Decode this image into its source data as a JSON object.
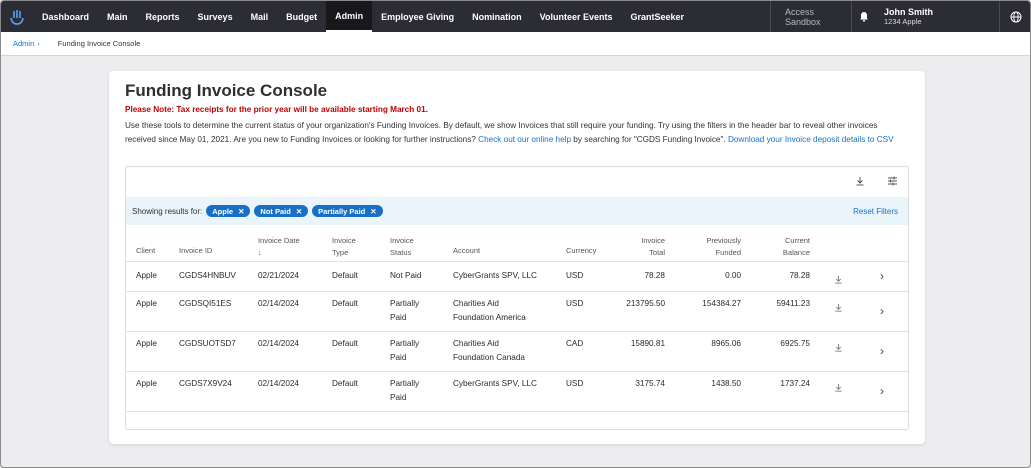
{
  "nav": {
    "items": [
      "Dashboard",
      "Main",
      "Reports",
      "Surveys",
      "Mail",
      "Budget",
      "Admin",
      "Employee Giving",
      "Nomination",
      "Volunteer Events",
      "GrantSeeker"
    ],
    "active": "Admin",
    "sandbox": "Access Sandbox",
    "user_name": "John Smith",
    "user_org": "1234 Apple"
  },
  "breadcrumb": {
    "parent": "Admin",
    "separator": "›",
    "current": "Funding Invoice Console"
  },
  "page": {
    "title": "Funding Invoice Console",
    "note": "Please Note: Tax receipts for the prior year will be available starting March 01.",
    "desc_1": "Use these tools to determine the current status of your organization's Funding Invoices. By default, we show Invoices that still require your funding. Try using the filters in the header bar to reveal other invoices received since May 01, 2021. Are you new to Funding Invoices or looking for further instructions? ",
    "help_link": "Check out our online help",
    "desc_2": " by searching for \"CGDS Funding Invoice\". ",
    "csv_link": "Download your Invoice deposit details to CSV"
  },
  "filters": {
    "label": "Showing results for:",
    "chips": [
      "Apple",
      "Not Paid",
      "Partially Paid"
    ],
    "reset": "Reset Filters"
  },
  "table": {
    "headers": {
      "client": "Client",
      "invoice_id": "Invoice ID",
      "invoice_date": "Invoice Date",
      "invoice_type_1": "Invoice",
      "invoice_type_2": "Type",
      "invoice_status_1": "Invoice",
      "invoice_status_2": "Status",
      "account": "Account",
      "currency": "Currency",
      "invoice_total_1": "Invoice",
      "invoice_total_2": "Total",
      "prev_funded_1": "Previously",
      "prev_funded_2": "Funded",
      "cur_balance_1": "Current",
      "cur_balance_2": "Balance"
    },
    "rows": [
      {
        "client": "Apple",
        "id": "CGDS4HNBUV",
        "date": "02/21/2024",
        "type": "Default",
        "status_1": "Not Paid",
        "status_2": "",
        "account_1": "CyberGrants SPV, LLC",
        "account_2": "",
        "currency": "USD",
        "total": "78.28",
        "funded": "0.00",
        "balance": "78.28"
      },
      {
        "client": "Apple",
        "id": "CGDSQI51ES",
        "date": "02/14/2024",
        "type": "Default",
        "status_1": "Partially",
        "status_2": "Paid",
        "account_1": "Charities Aid",
        "account_2": "Foundation America",
        "currency": "USD",
        "total": "213795.50",
        "funded": "154384.27",
        "balance": "59411.23"
      },
      {
        "client": "Apple",
        "id": "CGDSUOTSD7",
        "date": "02/14/2024",
        "type": "Default",
        "status_1": "Partially",
        "status_2": "Paid",
        "account_1": "Charities Aid",
        "account_2": "Foundation Canada",
        "currency": "CAD",
        "total": "15890.81",
        "funded": "8965.06",
        "balance": "6925.75"
      },
      {
        "client": "Apple",
        "id": "CGDS7X9V24",
        "date": "02/14/2024",
        "type": "Default",
        "status_1": "Partially",
        "status_2": "Paid",
        "account_1": "CyberGrants SPV, LLC",
        "account_2": "",
        "currency": "USD",
        "total": "3175.74",
        "funded": "1438.50",
        "balance": "1737.24"
      }
    ]
  }
}
